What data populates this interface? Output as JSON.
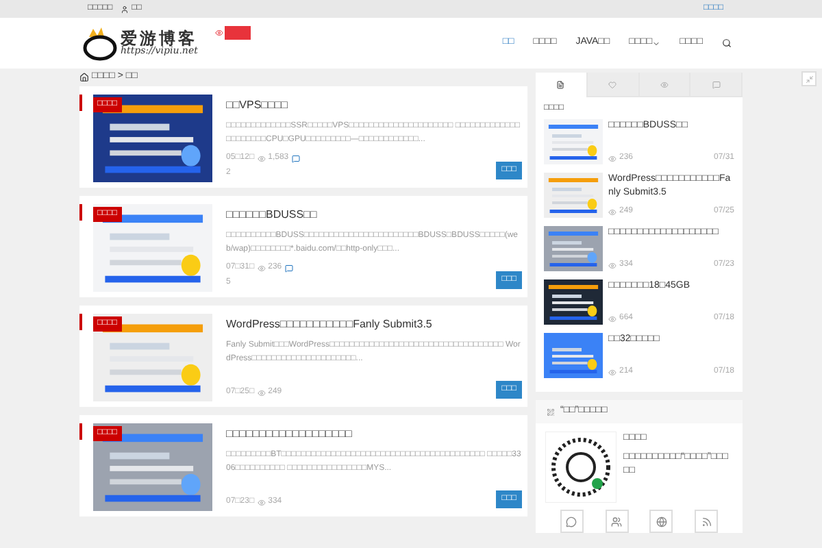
{
  "topbar": {
    "left_link": "□□□□□",
    "user_link": "□□",
    "right_link": "□□□□"
  },
  "logo": {
    "title": "爱游博客",
    "url": "https://vipiu.net"
  },
  "nav": [
    {
      "label": "□□",
      "selected": true,
      "dropdown": false
    },
    {
      "label": "□□□□",
      "selected": false,
      "dropdown": false
    },
    {
      "label": "JAVA□□",
      "selected": false,
      "dropdown": false
    },
    {
      "label": "□□□□",
      "selected": false,
      "dropdown": true
    },
    {
      "label": "□□□□",
      "selected": false,
      "dropdown": false
    }
  ],
  "breadcrumb": {
    "home": "□□□□",
    "separator": ">",
    "current": "□□"
  },
  "posts": [
    {
      "badge": "□□□□",
      "title": "□□VPS□□□□",
      "excerpt": "□□□□□□□□□□□□□SSR□□□□□VPS□□□□□□□□□□□□□□□□□□□□□ □□□□□□□□□□□□□□□□□□□□□CPU□GPU□□□□□□□□□—□□□□□□□□□□□□...",
      "date": "05□12□",
      "views": "1,583",
      "comments": "2",
      "button": "□□□"
    },
    {
      "badge": "□□□□",
      "title": "□□□□□□BDUSS□□",
      "excerpt": "□□□□□□□□□□BDUSS□□□□□□□□□□□□□□□□□□□□□□□BDUSS□BDUSS□□□□□(web/wap)□□□□□□□□*.baidu.com/□□http-only□□□...",
      "date": "07□31□",
      "views": "236",
      "comments": "5",
      "button": "□□□"
    },
    {
      "badge": "□□□□",
      "title": "WordPress□□□□□□□□□□□Fanly Submit3.5",
      "excerpt": "Fanly Submit□□□WordPress□□□□□□□□□□□□□□□□□□□□□□□□□□□□□□□□□□□ WordPress□□□□□□□□□□□□□□□□□□□□□...",
      "date": "07□25□",
      "views": "249",
      "button": "□□□"
    },
    {
      "badge": "□□□□",
      "title": "□□□□□□□□□□□□□□□□□□□",
      "excerpt": "□□□□□□□□□BT□□□□□□□□□□□□□□□□□□□□□□□□□□□□□□□□□□□□□□□□□ □□□□□3306□□□□□□□□□□ □□□□□□□□□□□□□□□□MYS...",
      "date": "07□23□",
      "views": "334",
      "button": "□□□"
    }
  ],
  "sidebar": {
    "tabs": [
      {
        "selected": true
      },
      {
        "selected": false
      },
      {
        "selected": false
      },
      {
        "selected": false
      }
    ],
    "heading": "□□□□",
    "items": [
      {
        "title": "□□□□□□BDUSS□□",
        "views": "236",
        "date": "07/31"
      },
      {
        "title": "WordPress□□□□□□□□□□□Fanly Submit3.5",
        "views": "249",
        "date": "07/25"
      },
      {
        "title": "□□□□□□□□□□□□□□□□□□□",
        "views": "334",
        "date": "07/23"
      },
      {
        "title": "□□□□□□□18□45GB",
        "views": "664",
        "date": "07/18"
      },
      {
        "title": "□□32□□□□□",
        "views": "214",
        "date": "07/18"
      }
    ]
  },
  "follow": {
    "heading": "“□□”□□□□□",
    "title": "□□□□",
    "text": "□□□□□□□□□□“□□□□”□□□□□"
  }
}
